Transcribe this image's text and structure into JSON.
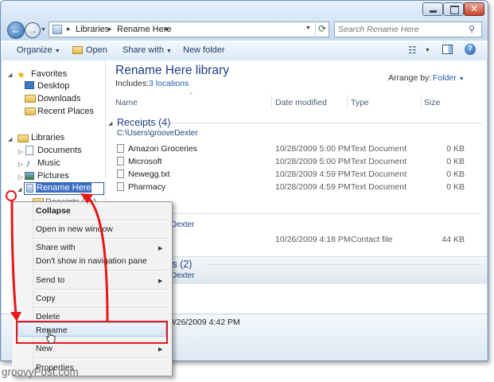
{
  "address": {
    "crumbs": [
      "Libraries",
      "Rename Here"
    ]
  },
  "search": {
    "placeholder": "Search Rename Here"
  },
  "toolbar": {
    "organize": "Organize",
    "open": "Open",
    "share_with": "Share with",
    "new_folder": "New folder"
  },
  "navpane": {
    "favorites": "Favorites",
    "favorites_items": [
      "Desktop",
      "Downloads",
      "Recent Places"
    ],
    "libraries": "Libraries",
    "libraries_items": [
      "Documents",
      "Music",
      "Pictures"
    ],
    "rename_value": "Rename Here",
    "child_partial": "Receipts (C:)"
  },
  "library": {
    "title": "Rename Here library",
    "includes_label": "Includes:",
    "includes_link": "3 locations",
    "arrange_label": "Arrange by:",
    "arrange_value": "Folder"
  },
  "columns": [
    "Name",
    "Date modified",
    "Type",
    "Size"
  ],
  "groups": [
    {
      "title": "Receipts (4)",
      "path": "C:\\Users\\grooveDexter",
      "rows": [
        {
          "name": "Amazon Groceries",
          "date": "10/28/2009 5:00 PM",
          "type": "Text Document",
          "size": "0 KB"
        },
        {
          "name": "Microsoft",
          "date": "10/28/2009 5:00 PM",
          "type": "Text Document",
          "size": "0 KB"
        },
        {
          "name": "Newegg.txt",
          "date": "10/28/2009 4:59 PM",
          "type": "Text Document",
          "size": "0 KB"
        },
        {
          "name": "Pharmacy",
          "date": "10/28/2009 4:59 PM",
          "type": "Text Document",
          "size": "0 KB"
        }
      ]
    },
    {
      "path_partial": "Dexter",
      "rows": [
        {
          "date": "10/26/2009 4:18 PM",
          "type": "Contact file",
          "size": "44 KB"
        }
      ]
    },
    {
      "title_partial": "ts (2)",
      "path_partial": "Dexter"
    }
  ],
  "details": {
    "date_partial": "0/26/2009 4:42 PM"
  },
  "context_menu": {
    "items": [
      "Collapse",
      "Open in new window",
      "Share with",
      "Don't show in navigation pane",
      "Send to",
      "Copy",
      "Delete",
      "Rename",
      "New",
      "Properties"
    ]
  },
  "watermark": "groovyPost.com",
  "colors": {
    "highlight_red": "#e3191b",
    "link_blue": "#1e3f82",
    "selection_blue": "#3a6dc4"
  }
}
